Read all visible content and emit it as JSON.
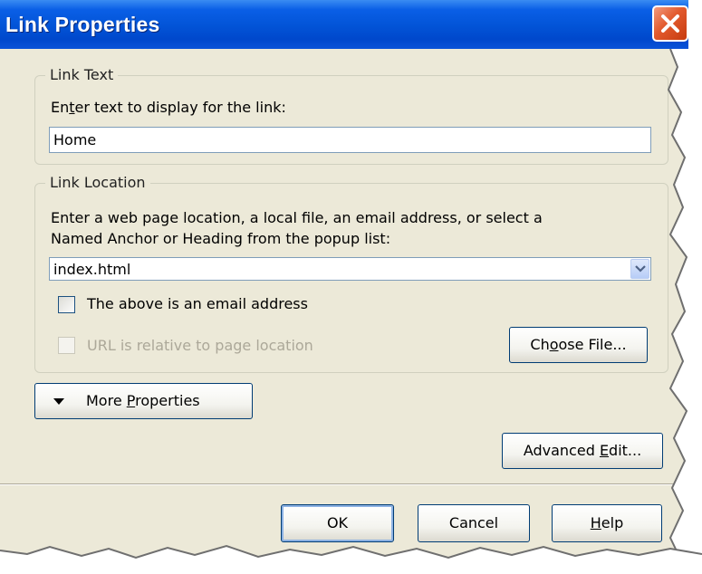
{
  "window": {
    "title": "Link Properties"
  },
  "link_text_group": {
    "legend": "Link Text",
    "prompt_pre": "En",
    "prompt_mn": "t",
    "prompt_post": "er text to display for the link:",
    "value": "Home"
  },
  "link_location_group": {
    "legend": "Link Location",
    "prompt_line1": "Enter a web page location, a local file, an email address, or select a",
    "prompt_line2": "Named Anchor or Heading from the popup list:",
    "value": "index.html",
    "email_checkbox_label": "The above is an email address",
    "relative_checkbox_label": "URL is relative to page location",
    "choose_file_pre": "Ch",
    "choose_file_mn": "o",
    "choose_file_post": "ose File..."
  },
  "more_properties": {
    "pre": "More ",
    "mn": "P",
    "post": "roperties"
  },
  "advanced_edit": {
    "pre": "Advanced ",
    "mn": "E",
    "post": "dit..."
  },
  "footer": {
    "ok_label": "OK",
    "cancel_label": "Cancel",
    "help_mn": "H",
    "help_post": "elp"
  },
  "colors": {
    "titlebar": "#0253d6",
    "dialog_bg": "#ece9d8",
    "close": "#e2592c"
  },
  "icons": [
    "close-icon",
    "dropdown-arrow-icon",
    "triangle-down-icon"
  ]
}
